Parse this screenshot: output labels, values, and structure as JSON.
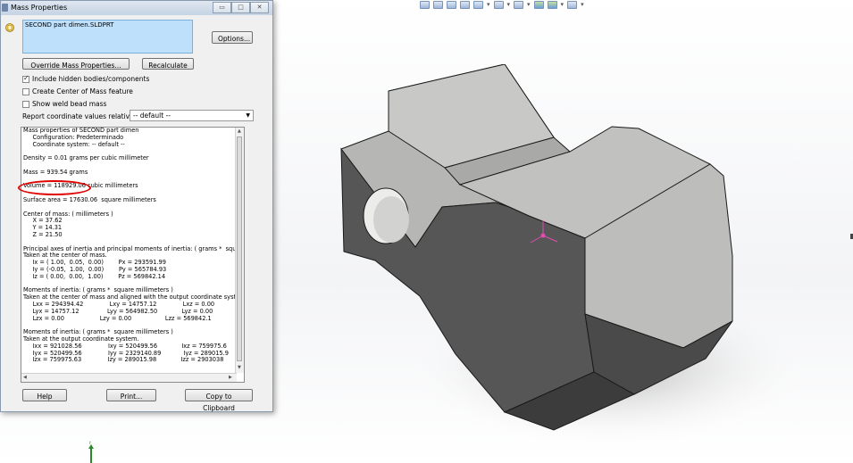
{
  "dialog": {
    "title": "Mass Properties",
    "win_buttons": [
      "▭",
      "□",
      "✕"
    ],
    "selected_file": "SECOND part dimen.SLDPRT",
    "options_label": "Options...",
    "override_label": "Override Mass Properties...",
    "recalc_label": "Recalculate",
    "checkboxes": [
      {
        "label": "Include hidden bodies/components",
        "checked": true
      },
      {
        "label": "Create Center of Mass feature",
        "checked": false
      },
      {
        "label": "Show weld bead mass",
        "checked": false
      }
    ],
    "report_label": "Report coordinate values relative to:",
    "coord_value": "-- default --",
    "results": [
      "Mass properties of SECOND part dimen",
      "     Configuration: Predeterminado",
      "     Coordinate system: -- default --",
      "",
      "Density = 0.01 grams per cubic millimeter",
      "",
      "Mass = 939.54 grams",
      "",
      "Volume = 118929.06 cubic millimeters",
      "",
      "Surface area = 17630.06  square millimeters",
      "",
      "Center of mass: ( millimeters )",
      "     X = 37.62",
      "     Y = 14.31",
      "     Z = 21.50",
      "",
      "Principal axes of inertia and principal moments of inertia: ( grams *  square",
      "Taken at the center of mass.",
      "     Ix = ( 1.00,  0.05,  0.00)        Px = 293591.99",
      "     Iy = (-0.05,  1.00,  0.00)        Py = 565784.93",
      "     Iz = ( 0.00,  0.00,  1.00)        Pz = 569842.14",
      "",
      "Moments of inertia: ( grams *  square millimeters )",
      "Taken at the center of mass and aligned with the output coordinate syste",
      "     Lxx = 294394.42              Lxy = 14757.12              Lxz = 0.00",
      "     Lyx = 14757.12               Lyy = 564982.50             Lyz = 0.00",
      "     Lzx = 0.00                   Lzy = 0.00                  Lzz = 569842.1",
      "",
      "Moments of inertia: ( grams *  square millimeters )",
      "Taken at the output coordinate system.",
      "     Ixx = 921028.56              Ixy = 520499.56             Ixz = 759975.6",
      "     Iyx = 520499.56              Iyy = 2329140.89            Iyz = 289015.9",
      "     Izx = 759975.63              Izy = 289015.98             Izz = 2903038"
    ],
    "help_label": "Help",
    "print_label": "Print...",
    "copy_label": "Copy to Clipboard"
  }
}
